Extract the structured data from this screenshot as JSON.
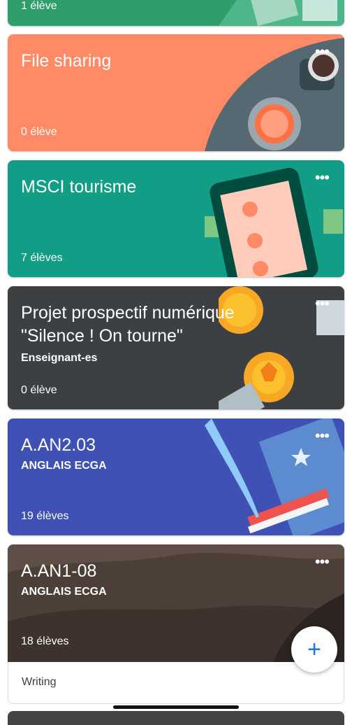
{
  "cards": [
    {
      "title": "",
      "subtitle": "",
      "count": "1 élève"
    },
    {
      "title": "File sharing",
      "subtitle": "",
      "count": "0 élève"
    },
    {
      "title": "MSCI tourisme",
      "subtitle": "",
      "count": "7 élèves"
    },
    {
      "title_line1": "Projet prospectif numérique",
      "title_line2": "\"Silence ! On tourne\"",
      "subtitle": "Enseignant-es",
      "count": "0 élève"
    },
    {
      "title": "A.AN2.03",
      "subtitle": "ANGLAIS ECGA",
      "count": "19 élèves"
    },
    {
      "title": "A.AN1-08",
      "subtitle": "ANGLAIS ECGA",
      "count": "18 élèves",
      "footer": "Writing"
    }
  ],
  "more_label": "•••",
  "fab_label": "+",
  "colors": {
    "card0": "#2e9e6b",
    "card1": "#ff8a65",
    "card2": "#129e86",
    "card3": "#3c4043",
    "card4": "#3f51b5",
    "card5": "#4c3f37",
    "fab_accent": "#1a73e8"
  },
  "icons": [
    "more-options-icon",
    "add-icon"
  ]
}
